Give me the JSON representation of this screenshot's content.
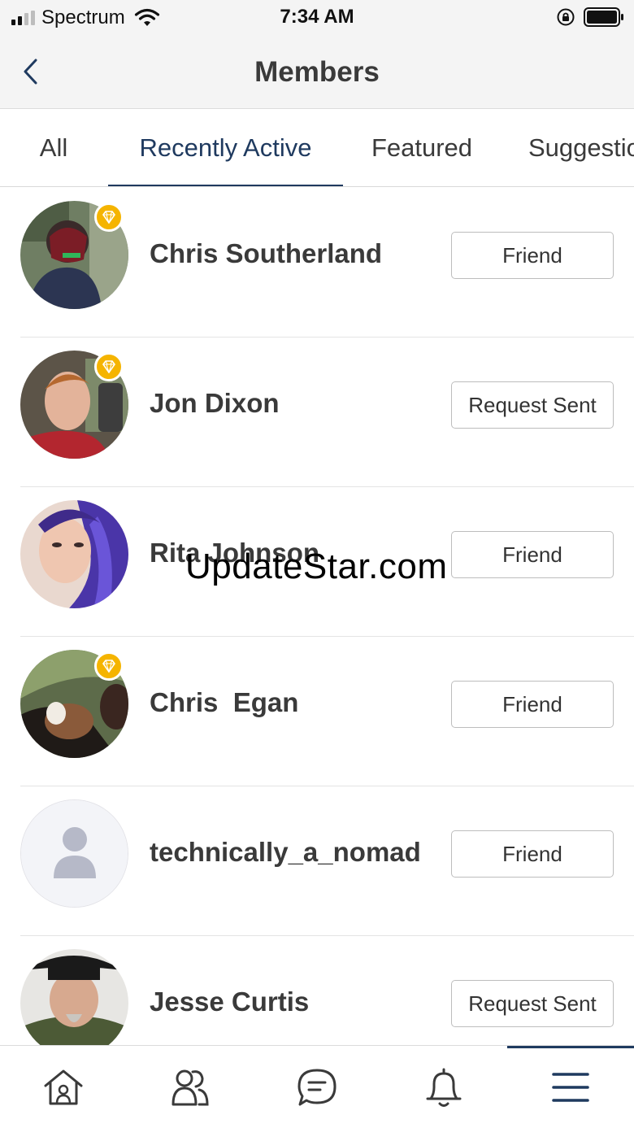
{
  "status_bar": {
    "carrier": "Spectrum",
    "time": "7:34 AM",
    "icons": [
      "signal-icon",
      "wifi-icon",
      "orientation-lock-icon",
      "battery-icon"
    ]
  },
  "header": {
    "title": "Members",
    "back_icon": "chevron-left-icon"
  },
  "tabs": [
    {
      "label": "All",
      "active": false
    },
    {
      "label": "Recently Active",
      "active": true
    },
    {
      "label": "Featured",
      "active": false
    },
    {
      "label": "Suggestions",
      "active": false
    }
  ],
  "members": [
    {
      "name": "Chris Southerland",
      "action": "Friend",
      "badge": true,
      "avatar": "photo"
    },
    {
      "name": "Jon Dixon",
      "action": "Request Sent",
      "badge": true,
      "avatar": "photo"
    },
    {
      "name": "Rita Johnson",
      "action": "Friend",
      "badge": false,
      "avatar": "photo"
    },
    {
      "name": "Chris  Egan",
      "action": "Friend",
      "badge": true,
      "avatar": "photo"
    },
    {
      "name": "technically_a_nomad",
      "action": "Friend",
      "badge": false,
      "avatar": "placeholder"
    },
    {
      "name": "Jesse Curtis",
      "action": "Request Sent",
      "badge": false,
      "avatar": "photo"
    }
  ],
  "watermark": "UpdateStar.com",
  "bottom_nav": [
    {
      "icon": "home-icon",
      "active": false
    },
    {
      "icon": "groups-icon",
      "active": false
    },
    {
      "icon": "messages-icon",
      "active": false
    },
    {
      "icon": "notifications-icon",
      "active": false
    },
    {
      "icon": "menu-icon",
      "active": true
    }
  ],
  "colors": {
    "accent": "#1f3a5f",
    "badge": "#f5b400",
    "header_bg": "#f4f4f4",
    "text": "#3a3a3a"
  }
}
